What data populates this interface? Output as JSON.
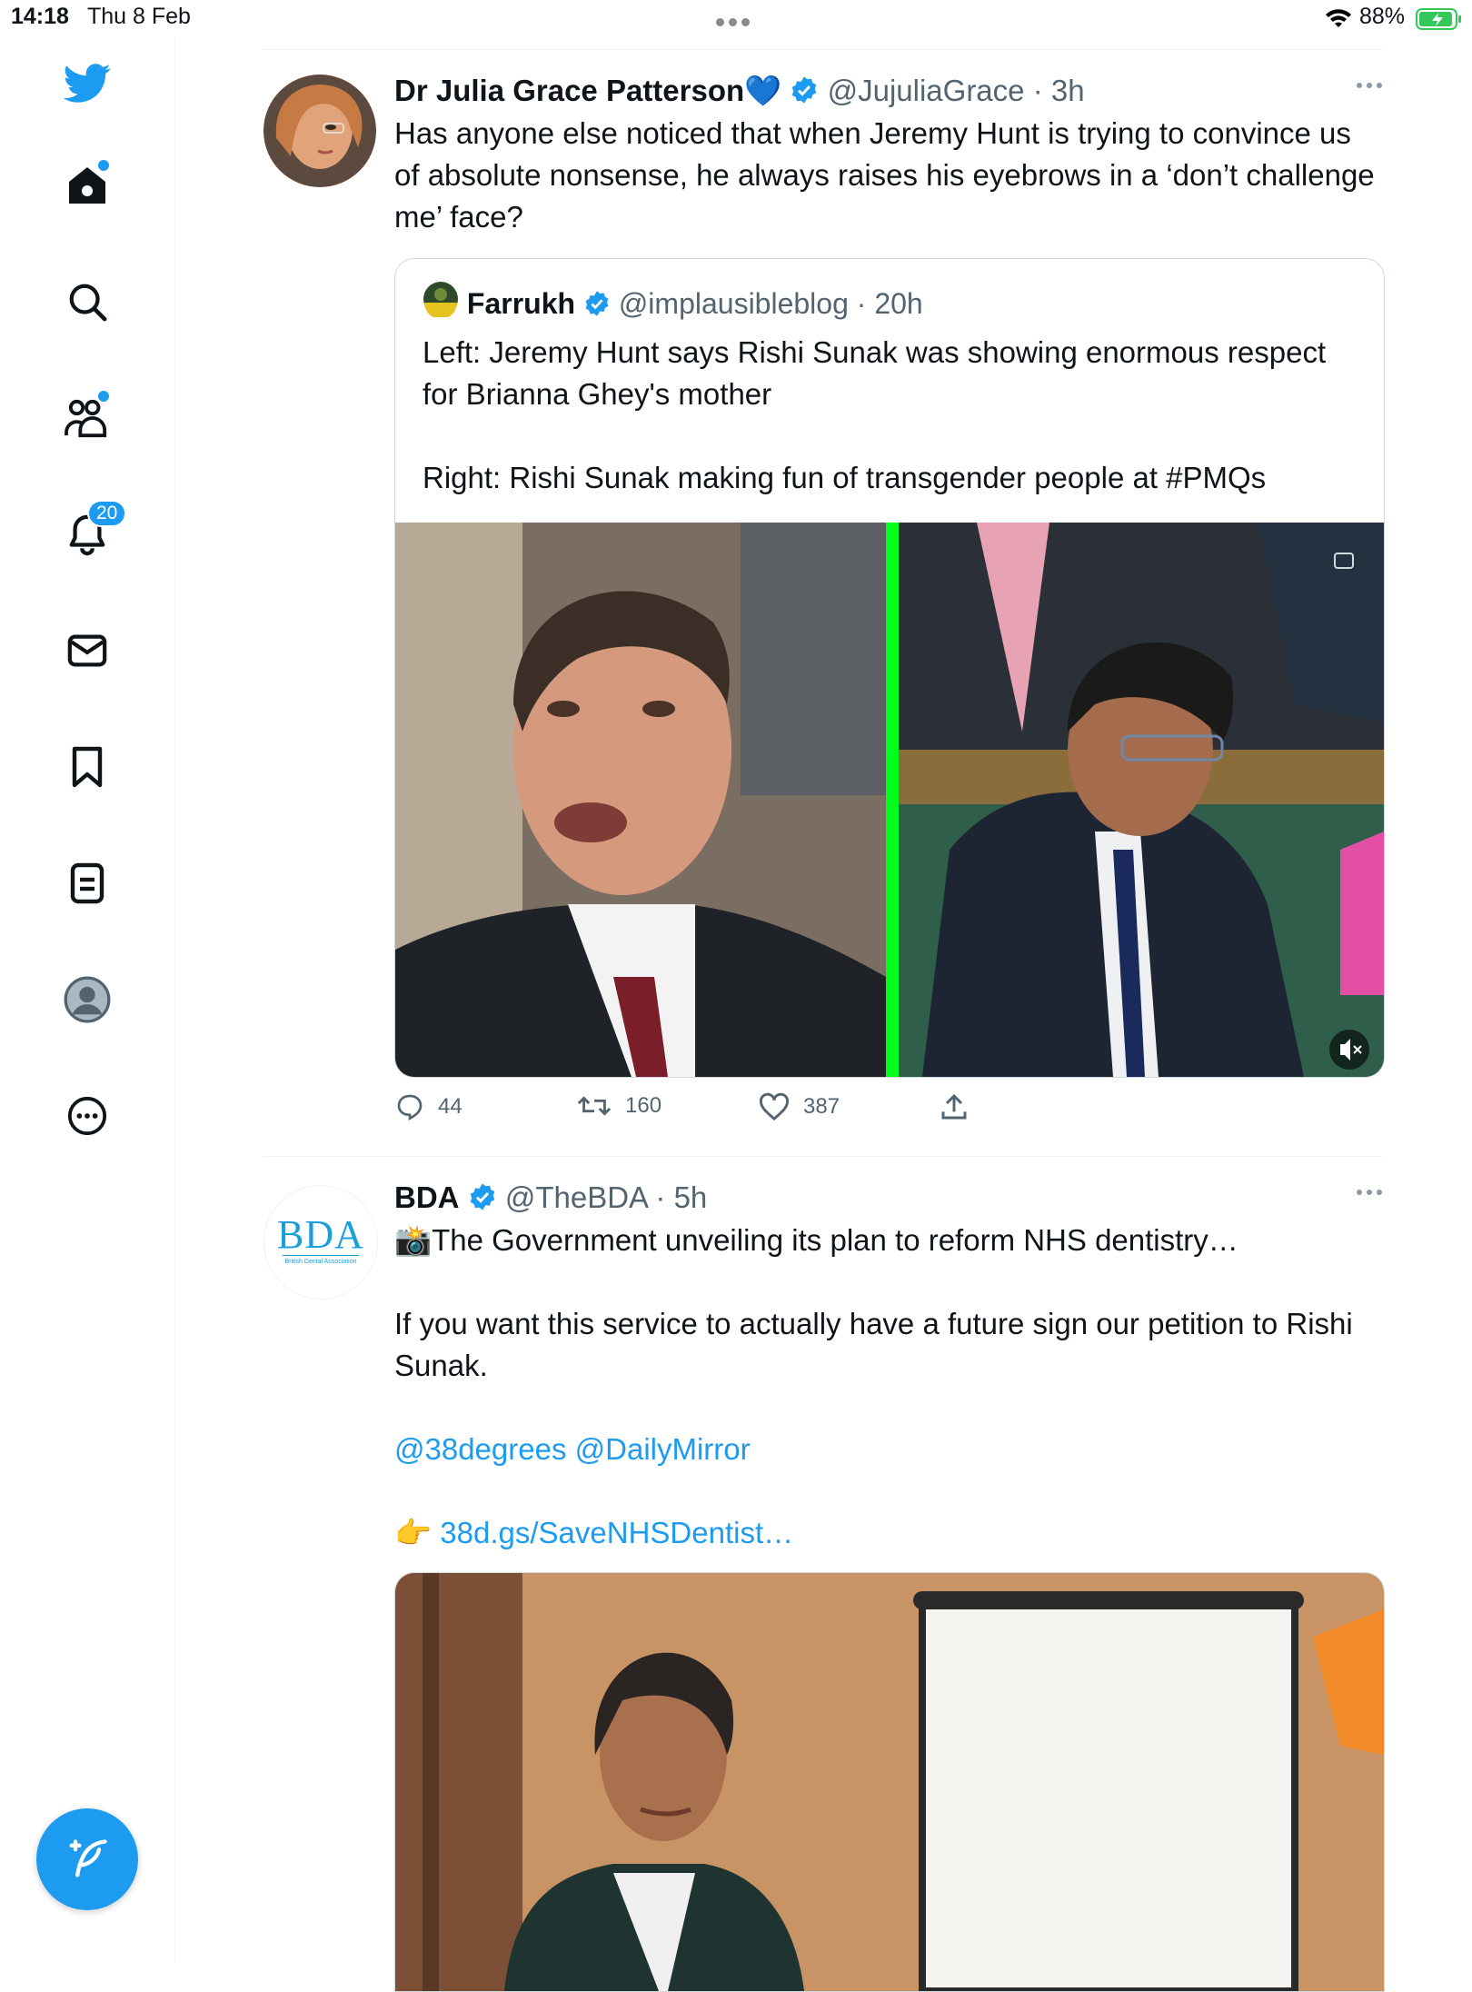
{
  "status": {
    "time": "14:18",
    "date": "Thu 8 Feb",
    "battery": "88%"
  },
  "sidebar": {
    "items": [
      {
        "name": "home",
        "icon": "home-icon",
        "dot": true
      },
      {
        "name": "explore",
        "icon": "search-icon"
      },
      {
        "name": "communities",
        "icon": "communities-icon",
        "dot": true
      },
      {
        "name": "notifications",
        "icon": "bell-icon",
        "badge": "20"
      },
      {
        "name": "messages",
        "icon": "mail-icon"
      },
      {
        "name": "bookmarks",
        "icon": "bookmark-icon"
      },
      {
        "name": "lists",
        "icon": "list-icon"
      },
      {
        "name": "profile",
        "icon": "avatar-icon"
      },
      {
        "name": "more",
        "icon": "more-icon"
      }
    ],
    "compose_icon": "compose-icon"
  },
  "tweets": [
    {
      "name": "Dr Julia Grace Patterson💙",
      "handle": "@JujuliaGrace",
      "time": "· 3h",
      "text": "Has anyone else noticed that when Jeremy Hunt is trying to convince us of absolute nonsense, he always raises his eyebrows in a ‘don’t challenge me’ face?",
      "quote": {
        "name": "Farrukh",
        "handle": "@implausibleblog",
        "time": "· 20h",
        "text1": "Left: Jeremy Hunt says Rishi Sunak was showing enormous respect for Brianna Ghey's mother",
        "text2": "Right: Rishi Sunak making fun of transgender people at #PMQs"
      },
      "replies": "44",
      "retweets": "160",
      "likes": "387"
    },
    {
      "name": "BDA",
      "handle": "@TheBDA",
      "time": "· 5h",
      "avatar_text": "BDA",
      "avatar_sub": "British Dental Association",
      "line1": "📸The Government unveiling its plan to reform NHS dentistry…",
      "line2": "If you want this service to actually have a future sign our petition to Rishi Sunak.",
      "mention1": "@38degrees",
      "mention2": "@DailyMirror",
      "emoji": "👉",
      "url": "38d.gs/SaveNHSDentist…"
    }
  ],
  "colors": {
    "accent": "#1d9bf0",
    "text": "#0f1419",
    "secondary": "#536471",
    "border": "#cfd9de",
    "divider_green": "#00ff1a"
  }
}
